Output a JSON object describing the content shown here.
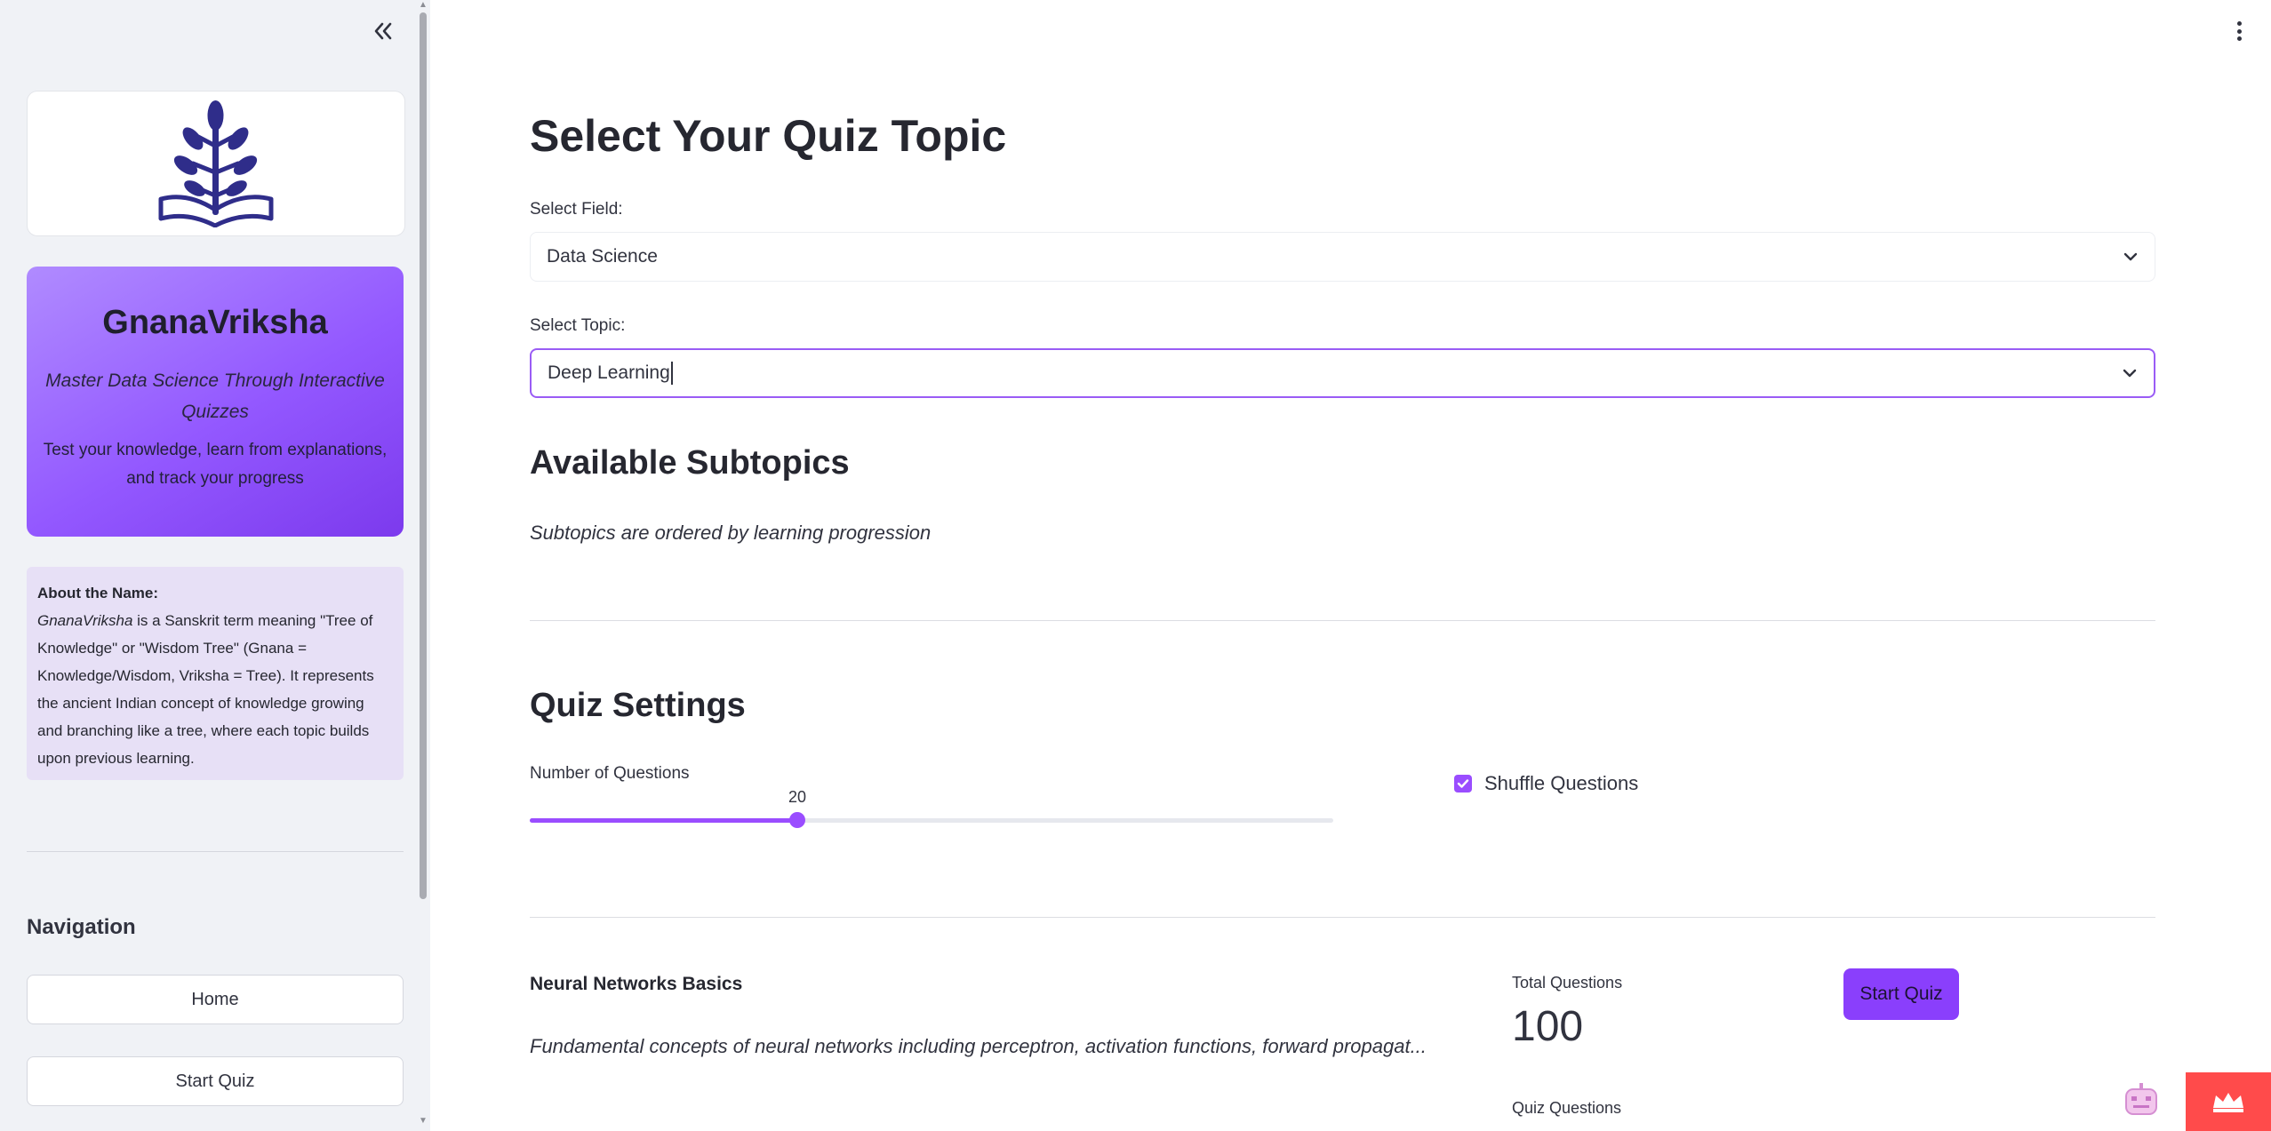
{
  "sidebar": {
    "collapse_icon": "double-chevron-left-icon",
    "logo_icon": "book-tree-logo",
    "brand": {
      "title": "GnanaVriksha",
      "tagline": "Master Data Science Through Interactive Quizzes",
      "description": "Test your knowledge, learn from explanations, and track your progress"
    },
    "about": {
      "heading": "About the Name:",
      "name_italic": "GnanaVriksha",
      "text": " is a Sanskrit term meaning \"Tree of Knowledge\" or \"Wisdom Tree\" (Gnana = Knowledge/Wisdom, Vriksha = Tree). It represents the ancient Indian concept of knowledge growing and branching like a tree, where each topic builds upon previous learning."
    },
    "navigation": {
      "heading": "Navigation",
      "items": [
        {
          "label": "Home"
        },
        {
          "label": "Start Quiz"
        }
      ]
    }
  },
  "main": {
    "menu_icon": "kebab-menu-icon",
    "title": "Select Your Quiz Topic",
    "field_select": {
      "label": "Select Field:",
      "value": "Data Science"
    },
    "topic_select": {
      "label": "Select Topic:",
      "value": "Deep Learning"
    },
    "subtopics": {
      "heading": "Available Subtopics",
      "note": "Subtopics are ordered by learning progression"
    },
    "settings": {
      "heading": "Quiz Settings",
      "num_questions_label": "Number of Questions",
      "num_questions_value": "20",
      "num_questions_fraction": 0.333,
      "shuffle_label": "Shuffle Questions",
      "shuffle_checked": true
    },
    "subtopic_card": {
      "title": "Neural Networks Basics",
      "description": "Fundamental concepts of neural networks including perceptron, activation functions, forward propagat...",
      "total_label": "Total Questions",
      "total_value": "100",
      "quiz_questions_label": "Quiz Questions",
      "start_button": "Start Quiz"
    }
  },
  "colors": {
    "accent": "#9a4dff",
    "brand_gradient_start": "#b08bff",
    "brand_gradient_end": "#7c3aed",
    "about_bg": "#e7e0f6",
    "corner_badge": "#ff4b4b"
  }
}
